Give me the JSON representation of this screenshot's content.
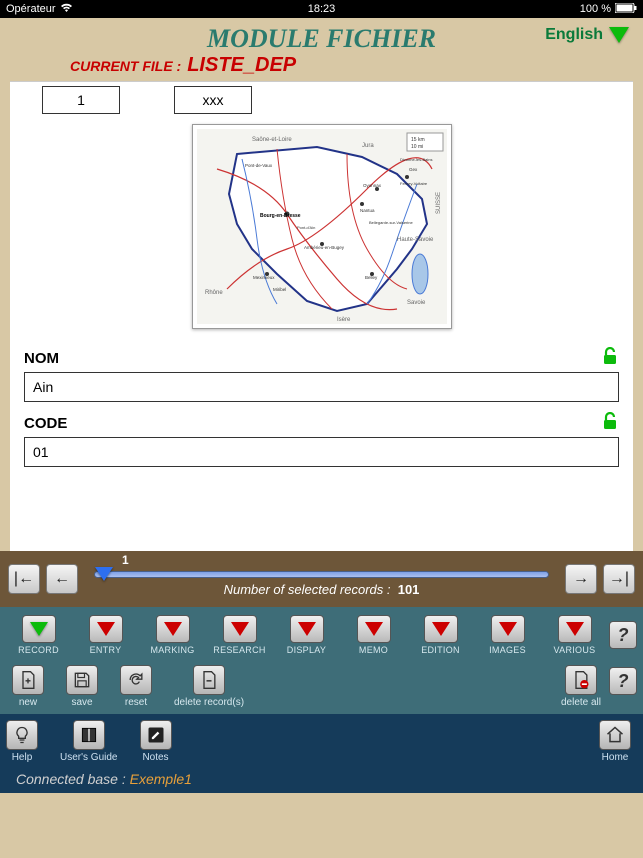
{
  "status": {
    "carrier": "Opérateur",
    "time": "18:23",
    "battery": "100 %"
  },
  "header": {
    "title": "MODULE FICHIER",
    "lang": "English",
    "current_file_label": "CURRENT FILE :",
    "current_file_name": "LISTE_DEP"
  },
  "top_boxes": {
    "a": "1",
    "b": "xxx"
  },
  "map": {
    "labels": {
      "tl": "Saône-et-Loire",
      "tr": "Jura",
      "l": "Rhône",
      "br": "Savoie",
      "b": "Isère",
      "r": "Haute-Savoie",
      "suisse": "SUISSE",
      "scale1": "15 km",
      "scale2": "10 mi",
      "city_bourg": "Bourg-en-Bresse",
      "city_pontdeveaux": "Pont-de-Vaux",
      "city_nantua": "Nantua",
      "city_oyonnax": "Oyonnax",
      "city_gex": "Gex",
      "city_ferney": "Ferney-Voltaire",
      "city_divonne": "Divonne-les-Bains",
      "city_ambérieu": "Ambérieu-en-Bugey",
      "city_belley": "Belley",
      "city_miribel": "Miribel",
      "city_pontain": "Pont-d'Ain",
      "city_bellegarde": "Bellegarde-sur-Valserine",
      "city_meximieux": "Meximieux"
    }
  },
  "fields": {
    "nom_label": "NOM",
    "nom_value": "Ain",
    "code_label": "CODE",
    "code_value": "01"
  },
  "nav": {
    "pos": "1",
    "records_label": "Number of selected records :",
    "records_count": "101"
  },
  "toolbar": {
    "items": [
      {
        "label": "RECORD"
      },
      {
        "label": "ENTRY"
      },
      {
        "label": "MARKING"
      },
      {
        "label": "RESEARCH"
      },
      {
        "label": "DISPLAY"
      },
      {
        "label": "MEMO"
      },
      {
        "label": "EDITION"
      },
      {
        "label": "IMAGES"
      },
      {
        "label": "VARIOUS"
      }
    ]
  },
  "secondary": {
    "new": "new",
    "save": "save",
    "reset": "reset",
    "delete_records": "delete record(s)",
    "delete_all": "delete all"
  },
  "bottom": {
    "help": "Help",
    "users_guide": "User's Guide",
    "notes": "Notes",
    "home": "Home"
  },
  "footer": {
    "label": "Connected base :",
    "base": "Exemple1"
  }
}
